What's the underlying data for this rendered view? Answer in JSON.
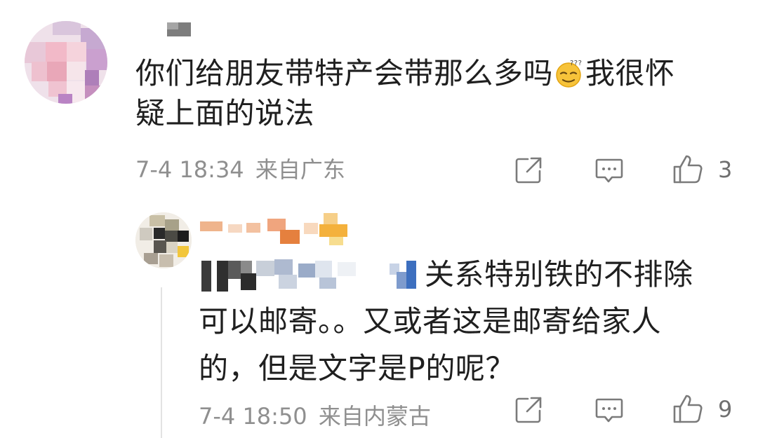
{
  "comments": [
    {
      "avatar": "blurred-avatar",
      "username": "",
      "text_line1_a": "你们给朋友带特产会带那么多吗",
      "emoji": "thinking-face-emoji",
      "text_line1_b": "我很怀",
      "text_line2": "疑上面的说法",
      "time": "7-4 18:34",
      "location": "来自广东",
      "likes": "3"
    }
  ],
  "reply": {
    "avatar": "blurred-avatar",
    "username": "",
    "mention": "",
    "text_line1": "关系特别铁的不排除",
    "text_line2": "可以邮寄。。又或者这是邮寄给家人",
    "text_line3": "的，但是文字是P的呢？",
    "time": "7-4 18:50",
    "location": "来自内蒙古",
    "likes": "9"
  },
  "icons": {
    "share": "share-icon",
    "comment": "comment-icon",
    "like": "thumbs-up-icon"
  },
  "colors": {
    "text": "#1f1f1f",
    "meta": "#8f8f8f",
    "icon": "#7a7a7a"
  }
}
